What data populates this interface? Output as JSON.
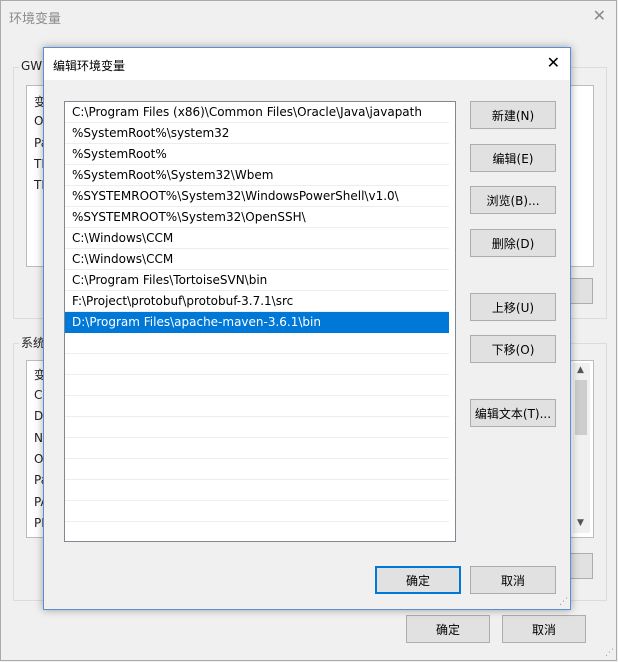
{
  "background_window": {
    "title": "环境变量",
    "user_group_label": "GW",
    "user_list_letters": [
      "变",
      "O",
      "Pa",
      "TE",
      "TM"
    ],
    "system_group_label": "系统",
    "system_list_letters": [
      "变",
      "Co",
      "Dr",
      "N",
      "O",
      "Pa",
      "PA",
      "PF"
    ],
    "ok_label": "确定",
    "cancel_label": "取消"
  },
  "dialog": {
    "title": "编辑环境变量",
    "entries": [
      "C:\\Program Files (x86)\\Common Files\\Oracle\\Java\\javapath",
      "%SystemRoot%\\system32",
      "%SystemRoot%",
      "%SystemRoot%\\System32\\Wbem",
      "%SYSTEMROOT%\\System32\\WindowsPowerShell\\v1.0\\",
      "%SYSTEMROOT%\\System32\\OpenSSH\\",
      "C:\\Windows\\CCM",
      "C:\\Windows\\CCM",
      "C:\\Program Files\\TortoiseSVN\\bin",
      "F:\\Project\\protobuf\\protobuf-3.7.1\\src",
      "D:\\Program Files\\apache-maven-3.6.1\\bin"
    ],
    "selected_index": 10,
    "buttons": {
      "new": "新建(N)",
      "edit": "编辑(E)",
      "browse": "浏览(B)...",
      "delete": "删除(D)",
      "move_up": "上移(U)",
      "move_down": "下移(O)",
      "edit_text": "编辑文本(T)..."
    },
    "ok_label": "确定",
    "cancel_label": "取消"
  },
  "colors": {
    "selection": "#0078d7",
    "dialog_border": "#5a8fd6"
  }
}
